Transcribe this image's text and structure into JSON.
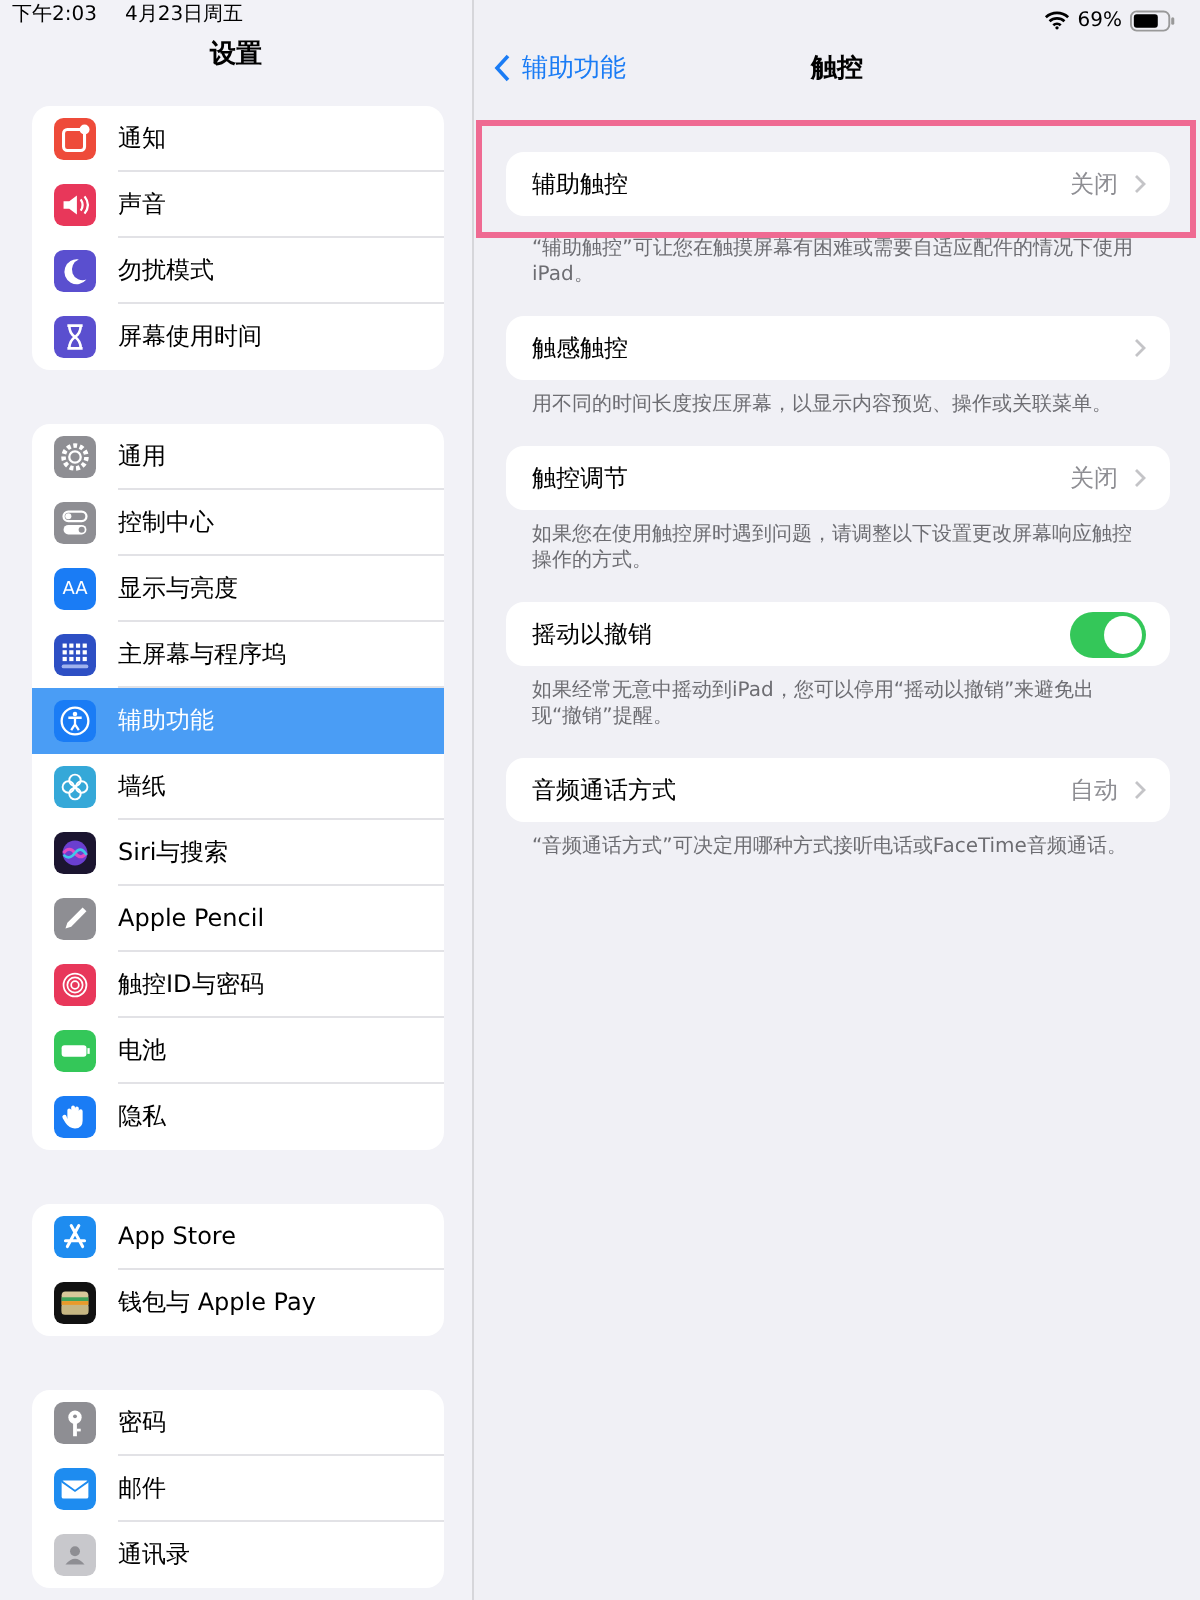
{
  "status_bar": {
    "time": "下午2:03",
    "date": "4月23日周五",
    "battery": "69%"
  },
  "sidebar": {
    "title": "设置",
    "groups": [
      [
        {
          "label": "通知",
          "selected": false
        },
        {
          "label": "声音",
          "selected": false
        },
        {
          "label": "勿扰模式",
          "selected": false
        },
        {
          "label": "屏幕使用时间",
          "selected": false
        }
      ],
      [
        {
          "label": "通用",
          "selected": false
        },
        {
          "label": "控制中心",
          "selected": false
        },
        {
          "label": "显示与亮度",
          "icon_text": "AA",
          "selected": false
        },
        {
          "label": "主屏幕与程序坞",
          "selected": false
        },
        {
          "label": "辅助功能",
          "selected": true
        },
        {
          "label": "墙纸",
          "selected": false
        },
        {
          "label": "Siri与搜索",
          "selected": false
        },
        {
          "label": "Apple Pencil",
          "selected": false
        },
        {
          "label": "触控ID与密码",
          "selected": false
        },
        {
          "label": "电池",
          "selected": false
        },
        {
          "label": "隐私",
          "selected": false
        }
      ],
      [
        {
          "label": "App Store",
          "selected": false
        },
        {
          "label": "钱包与 Apple Pay",
          "selected": false
        }
      ],
      [
        {
          "label": "密码",
          "selected": false
        },
        {
          "label": "邮件",
          "selected": false
        },
        {
          "label": "通讯录",
          "selected": false
        }
      ]
    ]
  },
  "detail": {
    "back": "辅助功能",
    "title": "触控",
    "rows": [
      {
        "kind": "link",
        "label": "辅助触控",
        "value": "关闭",
        "highlighted": true,
        "footer": "“辅助触控”可让您在触摸屏幕有困难或需要自适应配件的情况下使用iPad。"
      },
      {
        "kind": "link",
        "label": "触感触控",
        "highlighted": false,
        "footer": "用不同的时间长度按压屏幕，以显示内容预览、操作或关联菜单。"
      },
      {
        "kind": "link",
        "label": "触控调节",
        "value": "关闭",
        "highlighted": false,
        "footer": "如果您在使用触控屏时遇到问题，请调整以下设置更改屏幕响应触控操作的方式。"
      },
      {
        "kind": "toggle",
        "label": "摇动以撤销",
        "on": true,
        "highlighted": false,
        "footer": "如果经常无意中摇动到iPad，您可以停用“摇动以撤销”来避免出现“撤销”提醒。"
      },
      {
        "kind": "link",
        "label": "音频通话方式",
        "value": "自动",
        "highlighted": false,
        "footer": "“音频通话方式”可决定用哪种方式接听电话或FaceTime音频通话。"
      }
    ]
  }
}
